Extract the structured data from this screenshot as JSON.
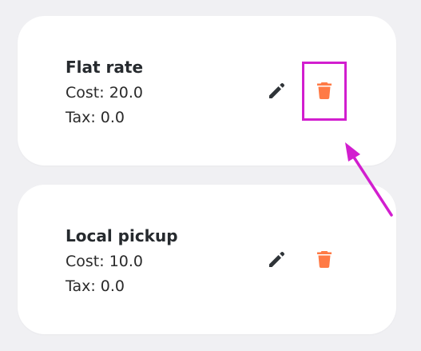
{
  "colors": {
    "background": "#f0f0f3",
    "card": "#ffffff",
    "edit_icon": "#2f3438",
    "delete_icon": "#ff7a45",
    "highlight": "#d21ecf"
  },
  "icons": {
    "edit": "pencil-icon",
    "delete": "trash-icon"
  },
  "shipping_methods": [
    {
      "title": "Flat rate",
      "cost_label": "Cost:",
      "cost_value": "20.0",
      "tax_label": "Tax:",
      "tax_value": "0.0"
    },
    {
      "title": "Local pickup",
      "cost_label": "Cost:",
      "cost_value": "10.0",
      "tax_label": "Tax:",
      "tax_value": "0.0"
    }
  ]
}
